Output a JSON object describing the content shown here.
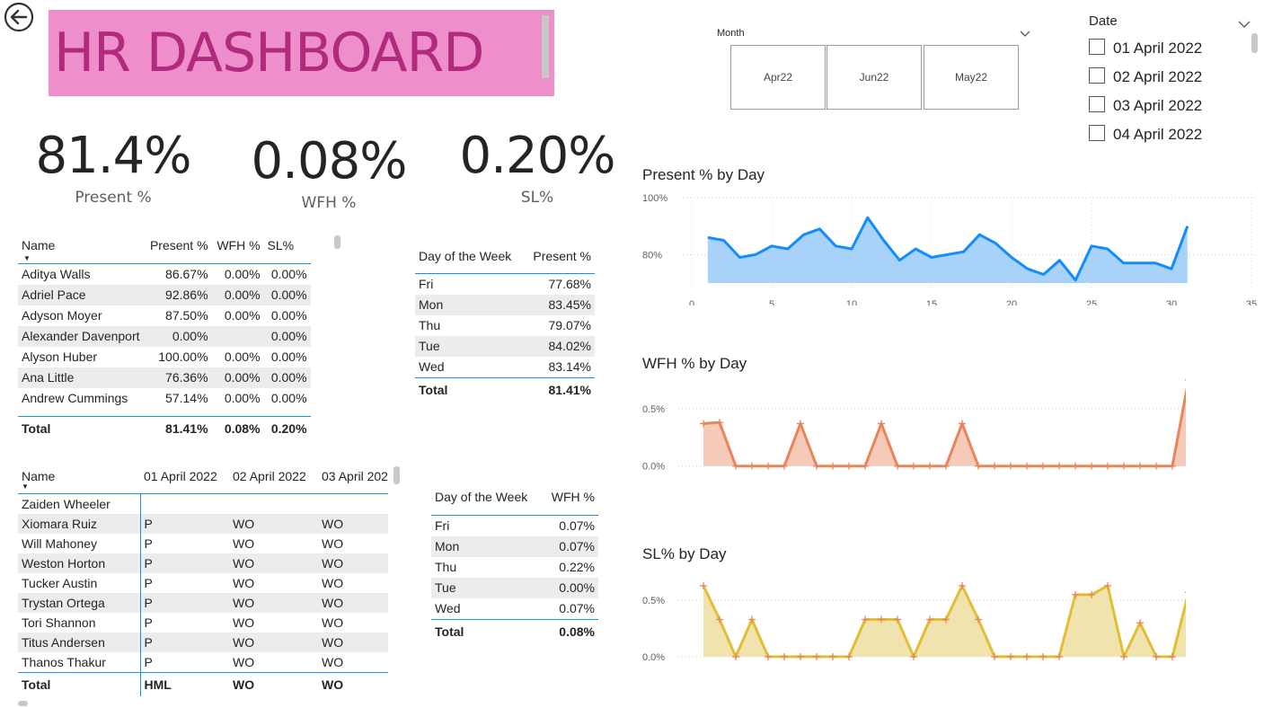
{
  "header": {
    "title": "HR DASHBOARD",
    "back_icon": "back-arrow-icon"
  },
  "kpis": [
    {
      "value": "81.4%",
      "label": "Present %"
    },
    {
      "value": "0.08%",
      "label": "WFH %"
    },
    {
      "value": "0.20%",
      "label": "SL%"
    }
  ],
  "month_slicer": {
    "label": "Month",
    "options": [
      "Apr22",
      "Jun22",
      "May22"
    ]
  },
  "date_slicer": {
    "label": "Date",
    "items": [
      "01 April 2022",
      "02 April 2022",
      "03 April 2022",
      "04 April 2022"
    ]
  },
  "employee_table": {
    "headers": [
      "Name",
      "Present %",
      "WFH %",
      "SL%"
    ],
    "rows": [
      [
        "Aditya Walls",
        "86.67%",
        "0.00%",
        "0.00%"
      ],
      [
        "Adriel Pace",
        "92.86%",
        "0.00%",
        "0.00%"
      ],
      [
        "Adyson Moyer",
        "87.50%",
        "0.00%",
        "0.00%"
      ],
      [
        "Alexander Davenport",
        "0.00%",
        "",
        "0.00%"
      ],
      [
        "Alyson Huber",
        "100.00%",
        "0.00%",
        "0.00%"
      ],
      [
        "Ana Little",
        "76.36%",
        "0.00%",
        "0.00%"
      ],
      [
        "Andrew Cummings",
        "57.14%",
        "0.00%",
        "0.00%"
      ]
    ],
    "total": [
      "Total",
      "81.41%",
      "0.08%",
      "0.20%"
    ]
  },
  "present_by_weekday": {
    "headers": [
      "Day of the Week",
      "Present %"
    ],
    "rows": [
      [
        "Fri",
        "77.68%"
      ],
      [
        "Mon",
        "83.45%"
      ],
      [
        "Thu",
        "79.07%"
      ],
      [
        "Tue",
        "84.02%"
      ],
      [
        "Wed",
        "83.14%"
      ]
    ],
    "total": [
      "Total",
      "81.41%"
    ]
  },
  "attendance_matrix": {
    "headers": [
      "Name",
      "01 April 2022",
      "02 April 2022",
      "03 April 202"
    ],
    "rows": [
      [
        "Zaiden Wheeler",
        "",
        "",
        ""
      ],
      [
        "Xiomara Ruiz",
        "P",
        "WO",
        "WO"
      ],
      [
        "Will Mahoney",
        "P",
        "WO",
        "WO"
      ],
      [
        "Weston Horton",
        "P",
        "WO",
        "WO"
      ],
      [
        "Tucker Austin",
        "P",
        "WO",
        "WO"
      ],
      [
        "Trystan Ortega",
        "P",
        "WO",
        "WO"
      ],
      [
        "Tori Shannon",
        "P",
        "WO",
        "WO"
      ],
      [
        "Titus Andersen",
        "P",
        "WO",
        "WO"
      ],
      [
        "Thanos Thakur",
        "P",
        "WO",
        "WO"
      ]
    ],
    "total": [
      "Total",
      "HML",
      "WO",
      "WO"
    ]
  },
  "wfh_by_weekday": {
    "headers": [
      "Day of the Week",
      "WFH %"
    ],
    "rows": [
      [
        "Fri",
        "0.07%"
      ],
      [
        "Mon",
        "0.07%"
      ],
      [
        "Thu",
        "0.22%"
      ],
      [
        "Tue",
        "0.00%"
      ],
      [
        "Wed",
        "0.07%"
      ]
    ],
    "total": [
      "Total",
      "0.08%"
    ]
  },
  "chart_data": [
    {
      "type": "area",
      "title": "Present % by Day",
      "color": "#118dff",
      "fill": "#a0cdfa",
      "xlim": [
        0,
        35
      ],
      "xticks": [
        "0",
        "5",
        "10",
        "15",
        "20",
        "25",
        "30",
        "35"
      ],
      "yticks": [
        {
          "v": 100,
          "label": "100%"
        },
        {
          "v": 80,
          "label": "80%"
        }
      ],
      "ylim": [
        70,
        100
      ],
      "x": [
        1,
        2,
        3,
        4,
        5,
        6,
        7,
        8,
        9,
        10,
        11,
        12,
        13,
        14,
        15,
        16,
        17,
        18,
        19,
        20,
        21,
        22,
        23,
        24,
        25,
        26,
        27,
        28,
        29,
        30,
        31
      ],
      "values": [
        86,
        85,
        79,
        80,
        83,
        82,
        87,
        89,
        83,
        82,
        93,
        85,
        78,
        82,
        79,
        80,
        81,
        87,
        84,
        79,
        75,
        73,
        78,
        71,
        83,
        82,
        77,
        77,
        77,
        75,
        90
      ]
    },
    {
      "type": "area",
      "title": "WFH % by Day",
      "color": "#e8855a",
      "fill": "#f5c4b0",
      "markers": true,
      "ylim": [
        -0.12,
        0.82
      ],
      "yticks": [
        {
          "v": 0.5,
          "label": "0.5%"
        },
        {
          "v": 0,
          "label": "0.0%"
        }
      ],
      "x": [
        1,
        2,
        3,
        4,
        5,
        6,
        7,
        8,
        9,
        10,
        11,
        12,
        13,
        14,
        15,
        16,
        17,
        18,
        19,
        20,
        21,
        22,
        23,
        24,
        25,
        26,
        27,
        28,
        29,
        30,
        31
      ],
      "values": [
        0.37,
        0.38,
        0,
        0,
        0,
        0,
        0.37,
        0,
        0,
        0,
        0,
        0.37,
        0,
        0,
        0,
        0,
        0.37,
        0,
        0,
        0,
        0,
        0,
        0,
        0,
        0,
        0,
        0,
        0,
        0,
        0,
        0.75,
        0
      ]
    },
    {
      "type": "area",
      "title": "SL% by Day",
      "color": "#e1be33",
      "fill": "#f0e0a5",
      "markers": true,
      "marker_color": "#e8855a",
      "ylim": [
        -0.12,
        0.82
      ],
      "yticks": [
        {
          "v": 0.5,
          "label": "0.5%"
        },
        {
          "v": 0,
          "label": "0.0%"
        }
      ],
      "x": [
        1,
        2,
        3,
        4,
        5,
        6,
        7,
        8,
        9,
        10,
        11,
        12,
        13,
        14,
        15,
        16,
        17,
        18,
        19,
        20,
        21,
        22,
        23,
        24,
        25,
        26,
        27,
        28,
        29,
        30,
        31
      ],
      "values": [
        0.63,
        0.33,
        0,
        0.33,
        0,
        0,
        0,
        0,
        0,
        0,
        0.33,
        0.33,
        0.33,
        0,
        0.33,
        0.33,
        0.63,
        0.33,
        0,
        0,
        0,
        0,
        0,
        0.55,
        0.55,
        0.63,
        0,
        0.3,
        0,
        0,
        0.57,
        0
      ]
    }
  ]
}
